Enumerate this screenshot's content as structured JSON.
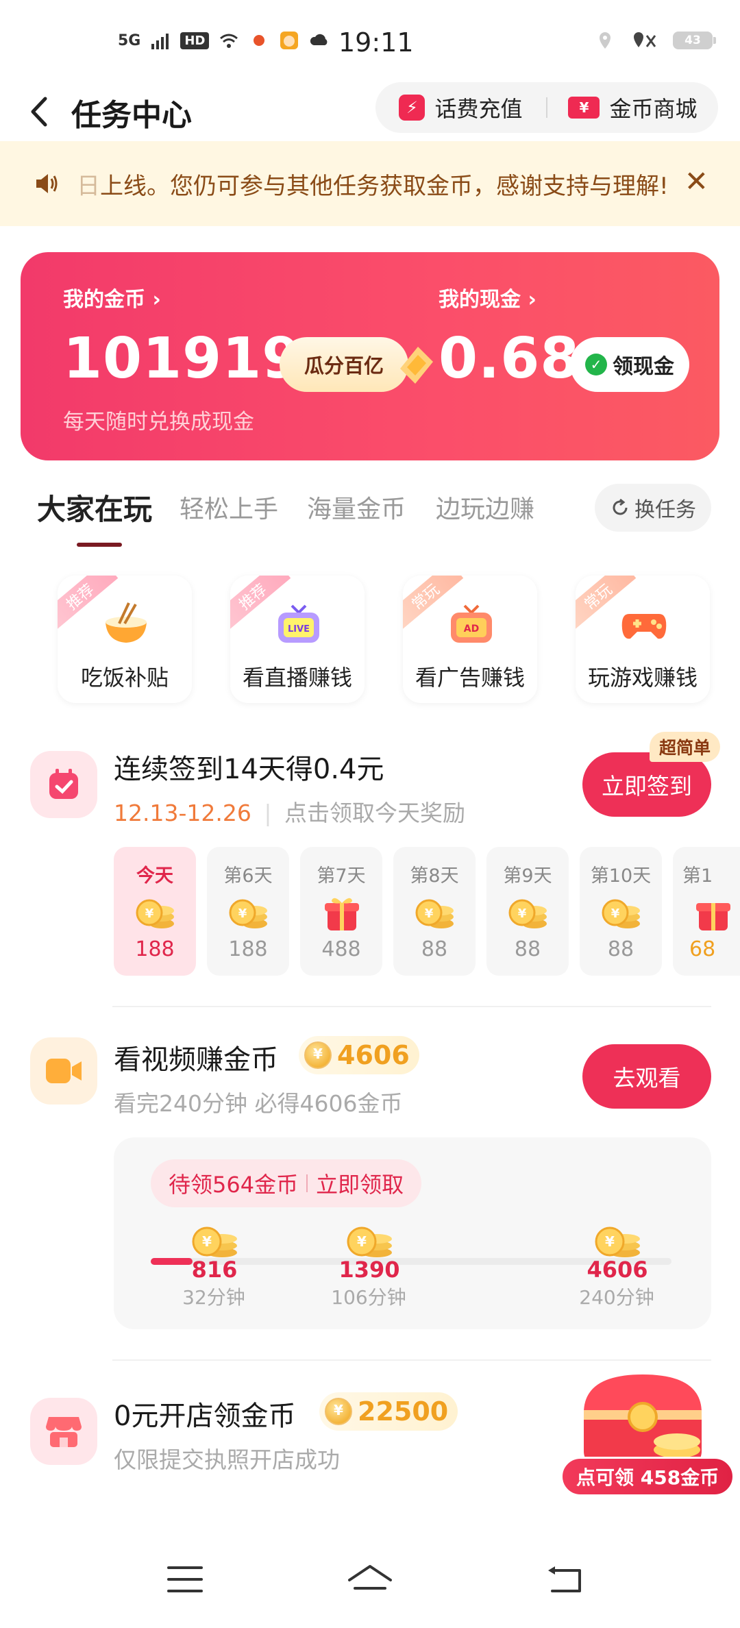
{
  "status_bar": {
    "network": "5G",
    "hd": "HD",
    "time": "19:11",
    "battery": "43"
  },
  "header": {
    "title": "任务中心",
    "btn_recharge": "话费充值",
    "btn_mall": "金币商城"
  },
  "notice": {
    "text": "上线。您仍可参与其他任务获取金币，感谢支持与理解!",
    "partial_char": "日",
    "close": "✕"
  },
  "wallet": {
    "coins_label": "我的金币",
    "coins_value": "101919",
    "coins_sub": "每天随时兑换成现金",
    "gua_label": "瓜分百亿",
    "cash_label": "我的现金",
    "cash_value": "0.68",
    "cash_btn": "领现金",
    "chevron": "›"
  },
  "tabs": {
    "items": [
      "大家在玩",
      "轻松上手",
      "海量金币",
      "边玩边赚"
    ],
    "active_index": 0,
    "swap_label": "换任务"
  },
  "quick_entries": [
    {
      "tag": "推荐",
      "label": "吃饭补贴",
      "icon": "noodle-bowl-icon"
    },
    {
      "tag": "推荐",
      "label": "看直播赚钱",
      "icon": "live-tv-icon"
    },
    {
      "tag": "常玩",
      "label": "看广告赚钱",
      "icon": "ad-tv-icon"
    },
    {
      "tag": "常玩",
      "label": "玩游戏赚钱",
      "icon": "gamepad-icon"
    }
  ],
  "checkin": {
    "title": "连续签到14天得0.4元",
    "date_range": "12.13-12.26",
    "hint": "点击领取今天奖励",
    "button": "立即签到",
    "badge": "超简单",
    "days": [
      {
        "label": "今天",
        "value": "188",
        "type": "coin"
      },
      {
        "label": "第6天",
        "value": "188",
        "type": "coin"
      },
      {
        "label": "第7天",
        "value": "488",
        "type": "gift"
      },
      {
        "label": "第8天",
        "value": "88",
        "type": "coin"
      },
      {
        "label": "第9天",
        "value": "88",
        "type": "coin"
      },
      {
        "label": "第10天",
        "value": "88",
        "type": "coin"
      },
      {
        "label": "第1",
        "value": "68",
        "type": "gift"
      }
    ]
  },
  "video_task": {
    "title": "看视频赚金币",
    "reward": "4606",
    "sub": "看完240分钟 必得4606金币",
    "button": "去观看",
    "pending": "待领564金币",
    "claim": "立即领取",
    "progress": 0.08,
    "milestones": [
      {
        "value": "816",
        "time": "32分钟"
      },
      {
        "value": "1390",
        "time": "106分钟"
      },
      {
        "value": "4606",
        "time": "240分钟"
      }
    ]
  },
  "shop_task": {
    "title": "0元开店领金币",
    "reward": "22500",
    "sub": "仅限提交执照开店成功",
    "float_label": "点可领 458金币"
  },
  "colors": {
    "accent": "#ee3057",
    "notice_bg": "#fff7e2",
    "notice_text": "#8a4b17"
  }
}
